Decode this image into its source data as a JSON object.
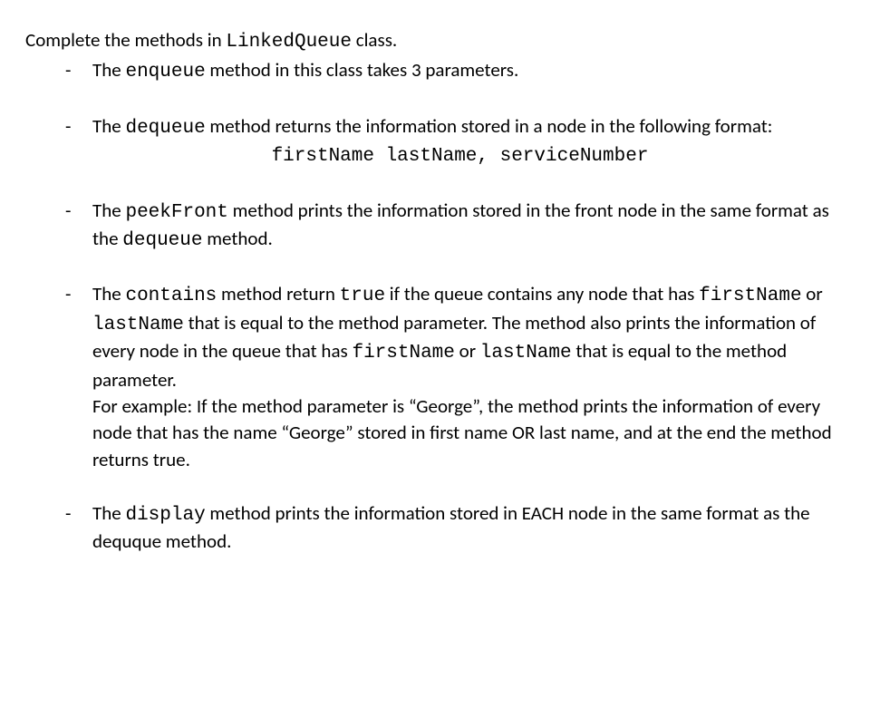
{
  "intro": {
    "prefix": "Complete the methods in ",
    "className": "LinkedQueue",
    "suffix": " class."
  },
  "items": {
    "enqueue": {
      "p1": "The ",
      "code1": "enqueue",
      "p2": " method in this class takes 3 parameters."
    },
    "dequeue": {
      "p1": "The ",
      "code1": "dequeue",
      "p2": " method returns the information stored in a node in the following format:",
      "format": "firstName lastName, serviceNumber"
    },
    "peekFront": {
      "p1": "The ",
      "code1": "peekFront",
      "p2": " method prints the information stored in the front node in the same format as the ",
      "code2": "dequeue",
      "p3": " method."
    },
    "contains": {
      "p1": "The ",
      "code1": "contains",
      "p2": " method return ",
      "code2": "true",
      "p3": " if the queue contains any node that has ",
      "code3": "firstName",
      "p4": " or ",
      "code4": "lastName",
      "p5": " that is equal to the method parameter. The method also prints the information of every node in the queue that has ",
      "code5": "firstName",
      "p6": " or ",
      "code6": "lastName",
      "p7": " that is equal to the method parameter.",
      "example": "For example: If the method parameter is “George”, the method prints the information of every node that has the name “George” stored in first name OR last name, and at the end the method returns true."
    },
    "display": {
      "p1": "The ",
      "code1": "display",
      "p2": " method prints the information stored in EACH node in the same format as the dequque method."
    }
  }
}
